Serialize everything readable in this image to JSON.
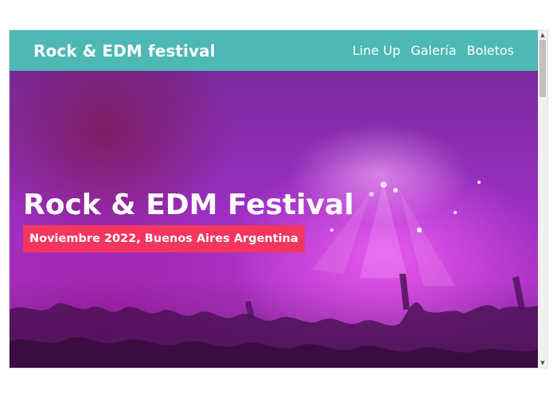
{
  "header": {
    "brand": "Rock & EDM festival",
    "nav": [
      "Line Up",
      "Galería",
      "Boletos"
    ],
    "background_color": "#4db8b4"
  },
  "hero": {
    "title": "Rock & EDM Festival",
    "subtitle": "Noviembre 2022, Buenos Aires Argentina",
    "subtitle_bg_color": "#f4365f",
    "image": "concert-crowd-purple-lights"
  }
}
